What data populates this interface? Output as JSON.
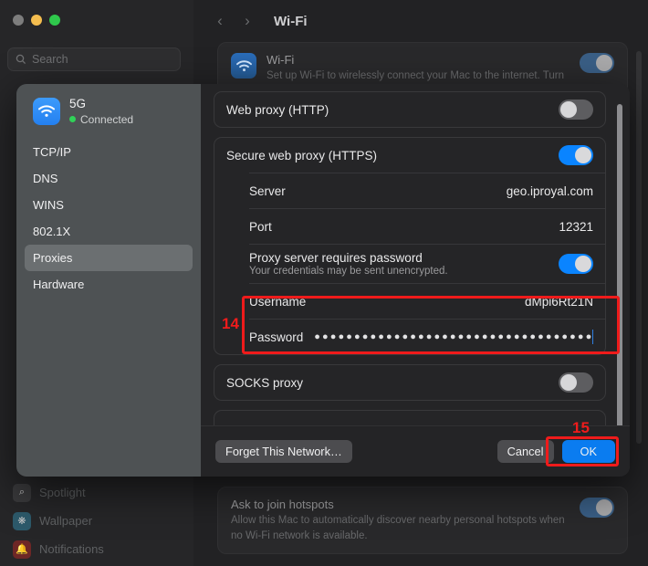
{
  "background": {
    "window_controls": [
      "close",
      "minimize",
      "zoom"
    ],
    "search": {
      "placeholder": "Search",
      "icon": "search-icon"
    },
    "nav_items": [
      {
        "label": "Spotlight",
        "icon": "spotlight-icon"
      },
      {
        "label": "Wallpaper",
        "icon": "wallpaper-icon"
      },
      {
        "label": "Notifications",
        "icon": "notifications-icon"
      }
    ],
    "toolbar": {
      "back_icon": "chevron-left-icon",
      "forward_icon": "chevron-right-icon",
      "title": "Wi-Fi"
    },
    "wifi_card": {
      "icon": "wifi-icon",
      "label": "Wi-Fi",
      "description": "Set up Wi-Fi to wirelessly connect your Mac to the internet. Turn",
      "toggle_on": true
    },
    "hotspots_card": {
      "label": "Ask to join hotspots",
      "description": "Allow this Mac to automatically discover nearby personal hotspots when no Wi-Fi network is available.",
      "toggle_on": true
    }
  },
  "dialog": {
    "network": {
      "icon": "wifi-icon",
      "name": "5G",
      "status": "Connected",
      "status_color": "#30d158"
    },
    "nav_items": [
      {
        "label": "TCP/IP",
        "selected": false
      },
      {
        "label": "DNS",
        "selected": false
      },
      {
        "label": "WINS",
        "selected": false
      },
      {
        "label": "802.1X",
        "selected": false
      },
      {
        "label": "Proxies",
        "selected": true
      },
      {
        "label": "Hardware",
        "selected": false
      }
    ],
    "sections": {
      "web_proxy": {
        "label": "Web proxy (HTTP)",
        "toggle_on": false
      },
      "secure_web_proxy": {
        "label": "Secure web proxy (HTTPS)",
        "toggle_on": true,
        "server_label": "Server",
        "server_value": "geo.iproyal.com",
        "port_label": "Port",
        "port_value": "12321",
        "requires_password_label": "Proxy server requires password",
        "requires_password_sub": "Your credentials may be sent unencrypted.",
        "requires_password_on": true,
        "username_label": "Username",
        "username_value": "dMpi6Rt21N",
        "password_label": "Password",
        "password_masked": "●●●●●●●●●●●●●●●●●●●●●●●●●●●●●●●●●●●●●●●●●●"
      },
      "socks_proxy": {
        "label": "SOCKS proxy",
        "toggle_on": false
      }
    },
    "footer": {
      "forget_label": "Forget This Network…",
      "cancel_label": "Cancel",
      "ok_label": "OK"
    }
  },
  "annotations": [
    {
      "number": "14",
      "target": "credentials-fields"
    },
    {
      "number": "15",
      "target": "ok-button"
    }
  ],
  "colors": {
    "accent": "#0a84ff",
    "annotation": "#ef1b1b",
    "status_green": "#30d158"
  }
}
